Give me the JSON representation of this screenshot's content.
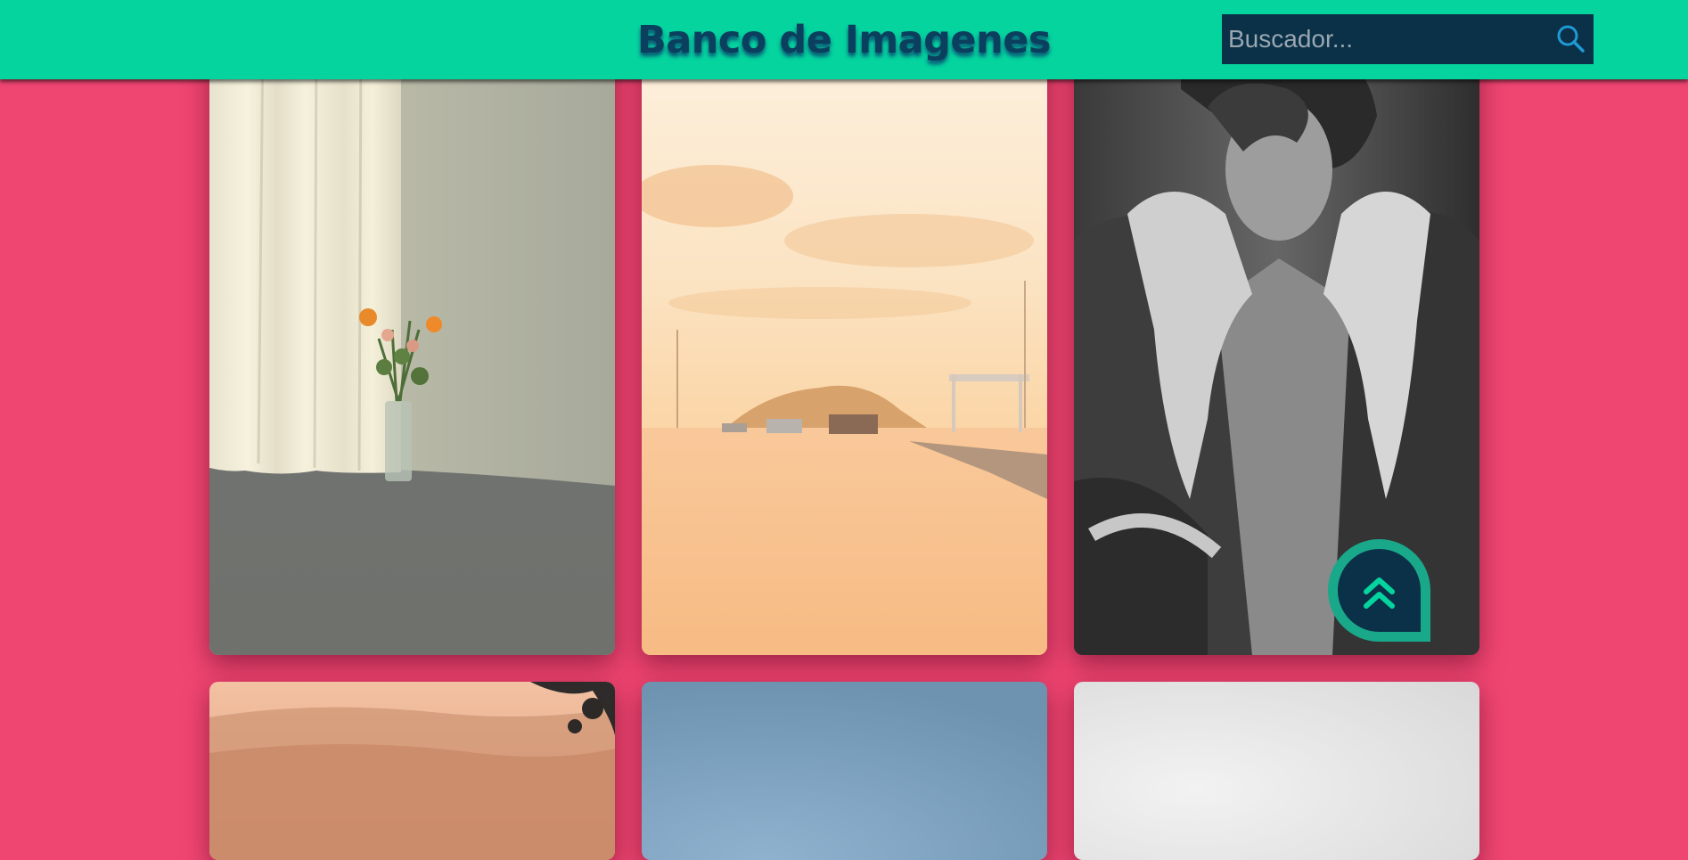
{
  "header": {
    "title": "Banco de Imagenes",
    "background_color": "#05d49f",
    "title_color": "#0b3f5e"
  },
  "search": {
    "placeholder": "Buscador...",
    "value": "",
    "icon": "search-icon",
    "background_color": "#0a3148"
  },
  "page": {
    "background_color": "#ef4571"
  },
  "gallery": {
    "images": [
      {
        "alt": "flowers-vase-curtain"
      },
      {
        "alt": "harbor-sunset"
      },
      {
        "alt": "woman-shearling-jacket"
      },
      {
        "alt": "misty-fields"
      },
      {
        "alt": "blue-sky"
      },
      {
        "alt": "white-backdrop"
      }
    ]
  },
  "scroll_top_button": {
    "icon": "double-chevron-up-icon",
    "color": "#0a3148",
    "ring_color": "#1aa88a"
  }
}
